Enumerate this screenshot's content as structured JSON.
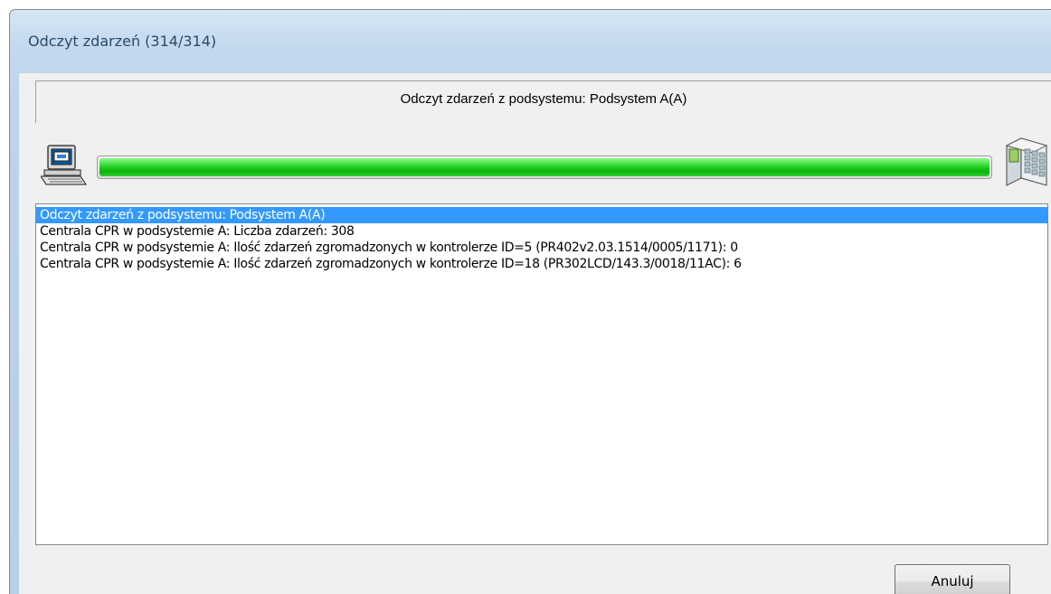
{
  "window": {
    "title": "Odczyt zdarzeń  (314/314)"
  },
  "header": {
    "text": "Odczyt zdarzeń z podsystemu: Podsystem A(A)"
  },
  "progress": {
    "value_percent": 100,
    "fill_color": "#18c818",
    "left_icon": "computer-icon",
    "right_icon": "controller-device-icon"
  },
  "log": {
    "selected_index": 0,
    "selection_color": "#3399ff",
    "lines": [
      "Odczyt zdarzeń z podsystemu: Podsystem A(A)",
      "Centrala CPR w podsystemie A: Liczba zdarzeń: 308",
      "Centrala CPR w podsystemie A: Ilość zdarzeń zgromadzonych w kontrolerze ID=5 (PR402v2.03.1514/0005/1171): 0",
      "Centrala CPR w podsystemie A: Ilość zdarzeń zgromadzonych w kontrolerze ID=18 (PR302LCD/143.3/0018/11AC): 6"
    ]
  },
  "buttons": {
    "cancel_label": "Anuluj"
  }
}
